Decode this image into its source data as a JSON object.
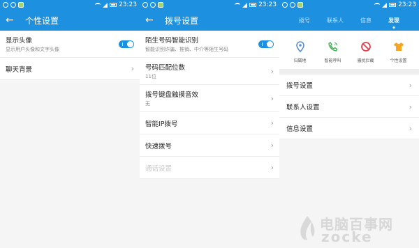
{
  "status": {
    "time": "23:23"
  },
  "screen1": {
    "title": "个性设置",
    "items": [
      {
        "label": "显示头像",
        "sub": "显示用户头像和文字头像"
      },
      {
        "label": "聊天背景"
      }
    ]
  },
  "screen2": {
    "title": "拨号设置",
    "items": [
      {
        "label": "陌生号码智能识别",
        "sub": "智能识别诈骗、推销、中介等陌生号码"
      },
      {
        "label": "号码匹配位数",
        "sub": "11位"
      },
      {
        "label": "拨号键盘触摸音效",
        "sub": "无"
      },
      {
        "label": "智能IP拨号"
      },
      {
        "label": "快速拨号"
      },
      {
        "label": "通话设置"
      }
    ]
  },
  "screen3": {
    "tabs": [
      "拨号",
      "联系人",
      "信息",
      "发现"
    ],
    "features": [
      {
        "label": "归属地",
        "icon": "location-pin-icon",
        "color": "#5b8fd1"
      },
      {
        "label": "智能呼叫",
        "icon": "phone-call-icon",
        "color": "#3fb34f"
      },
      {
        "label": "骚扰拦截",
        "icon": "block-icon",
        "color": "#e0404a"
      },
      {
        "label": "个性设置",
        "icon": "tshirt-icon",
        "color": "#f5a623"
      }
    ],
    "items": [
      {
        "label": "拨号设置"
      },
      {
        "label": "联系人设置"
      },
      {
        "label": "信息设置"
      }
    ]
  },
  "watermark": {
    "line1": "电脑百事网",
    "line2": "zocke"
  },
  "colors": {
    "accent": "#1e90e0"
  }
}
